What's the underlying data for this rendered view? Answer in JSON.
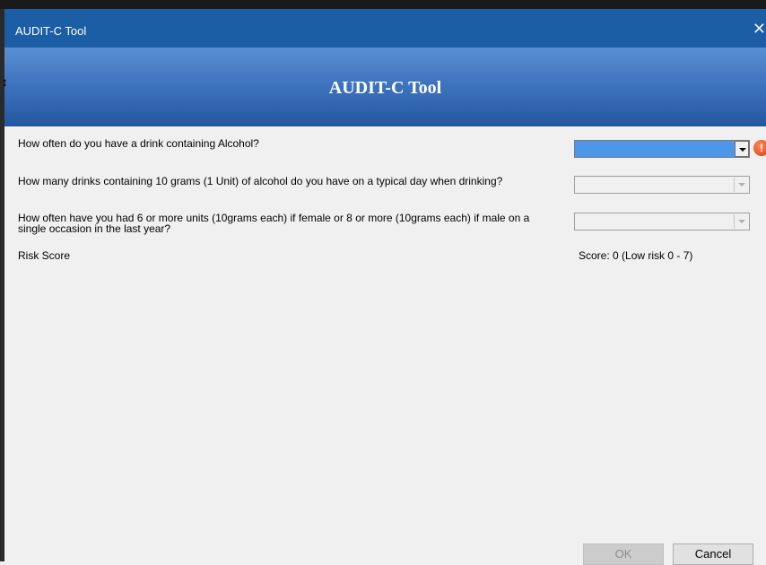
{
  "window": {
    "title": "AUDIT-C Tool",
    "close_symbol": "✕"
  },
  "banner": {
    "title": "AUDIT-C Tool"
  },
  "questions": [
    {
      "label": "How often do you have a drink containing Alcohol?",
      "value": ""
    },
    {
      "label": "How many drinks containing 10 grams (1 Unit) of alcohol do you have on a typical day when drinking?",
      "value": ""
    },
    {
      "label": "How often have you had 6 or more units (10grams each) if female or 8 or more (10grams each) if male on a single occasion in the last year?",
      "value": ""
    }
  ],
  "risk": {
    "label": "Risk Score",
    "score_text": "Score: 0 (Low risk 0 - 7)"
  },
  "validation": {
    "icon": "error-icon",
    "symbol": "!"
  },
  "buttons": {
    "ok": "OK",
    "cancel": "Cancel"
  },
  "colors": {
    "titlebar": "#1b5ea6",
    "banner_top": "#5b8fd3",
    "banner_bottom": "#2457a0",
    "selected_combo": "#4d96e8",
    "error": "#d23a10"
  }
}
